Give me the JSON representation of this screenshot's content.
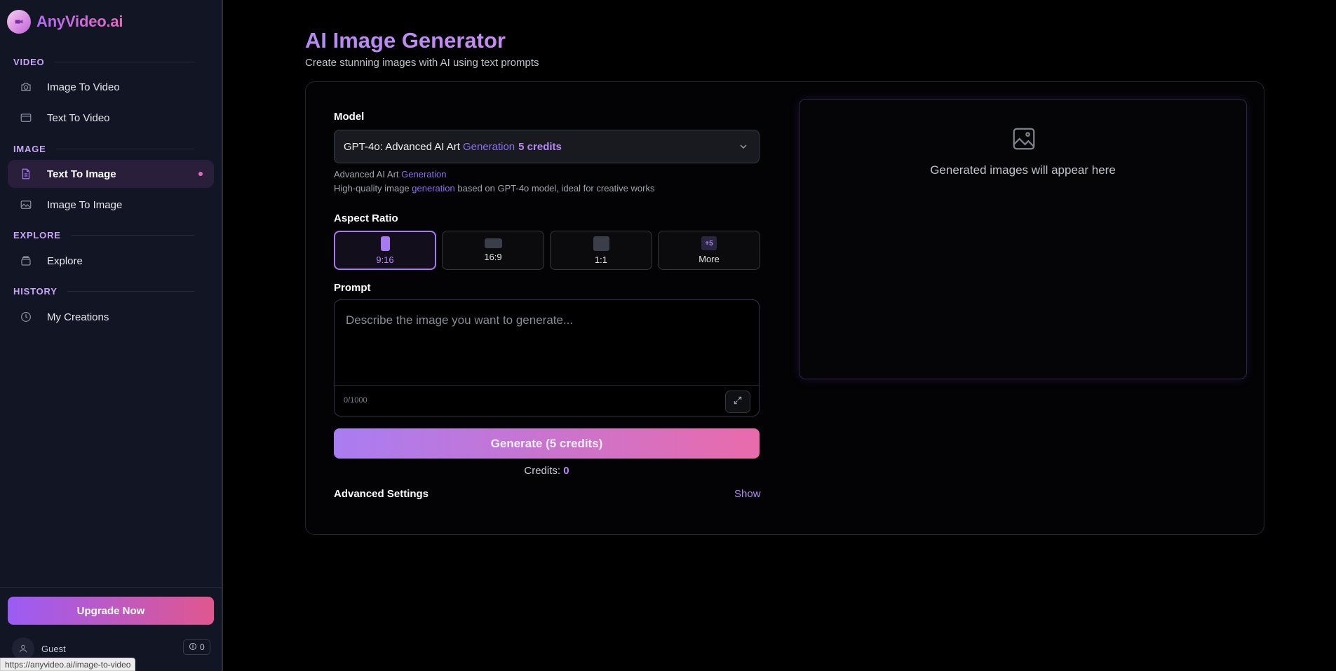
{
  "brand": {
    "name": "AnyVideo.ai"
  },
  "sidebar": {
    "sections": [
      {
        "label": "VIDEO"
      },
      {
        "label": "IMAGE"
      },
      {
        "label": "EXPLORE"
      },
      {
        "label": "HISTORY"
      }
    ],
    "items": [
      {
        "label": "Image To Video",
        "icon": "camera-icon"
      },
      {
        "label": "Text To Video",
        "icon": "video-frame-icon"
      },
      {
        "label": "Text To Image",
        "icon": "document-icon",
        "active": true
      },
      {
        "label": "Image To Image",
        "icon": "image-icon"
      },
      {
        "label": "Explore",
        "icon": "layers-icon"
      },
      {
        "label": "My Creations",
        "icon": "clock-icon"
      }
    ],
    "upgrade_label": "Upgrade Now",
    "user": {
      "name": "Guest",
      "credits": "0"
    }
  },
  "status_bar": {
    "url": "https://anyvideo.ai/image-to-video"
  },
  "page": {
    "title": "AI Image Generator",
    "subtitle": "Create stunning images with AI using text prompts"
  },
  "form": {
    "model_label": "Model",
    "model": {
      "name": "GPT-4o: Advanced AI Art",
      "name_accent": "Generation",
      "credits": "5 credits",
      "desc1_prefix": "Advanced AI Art",
      "desc1_accent": "Generation",
      "desc2_prefix": "High-quality image",
      "desc2_accent": "generation",
      "desc2_suffix": "based on GPT-4o model, ideal for creative works"
    },
    "aspect_label": "Aspect Ratio",
    "ratios": [
      {
        "label": "9:16",
        "selected": true
      },
      {
        "label": "16:9"
      },
      {
        "label": "1:1"
      },
      {
        "label": "More",
        "badge": "+5"
      }
    ],
    "prompt_label": "Prompt",
    "prompt_placeholder": "Describe the image you want to generate...",
    "prompt_value": "",
    "char_count": "0/1000",
    "generate_label": "Generate (5 credits)",
    "credits_prefix": "Credits:",
    "credits_value": "0",
    "advanced_label": "Advanced Settings",
    "advanced_toggle": "Show"
  },
  "preview": {
    "placeholder": "Generated images will appear here"
  },
  "colors": {
    "accent": "#b58af5",
    "gradient_start": "#9a5cf5",
    "gradient_end": "#e0578f"
  }
}
